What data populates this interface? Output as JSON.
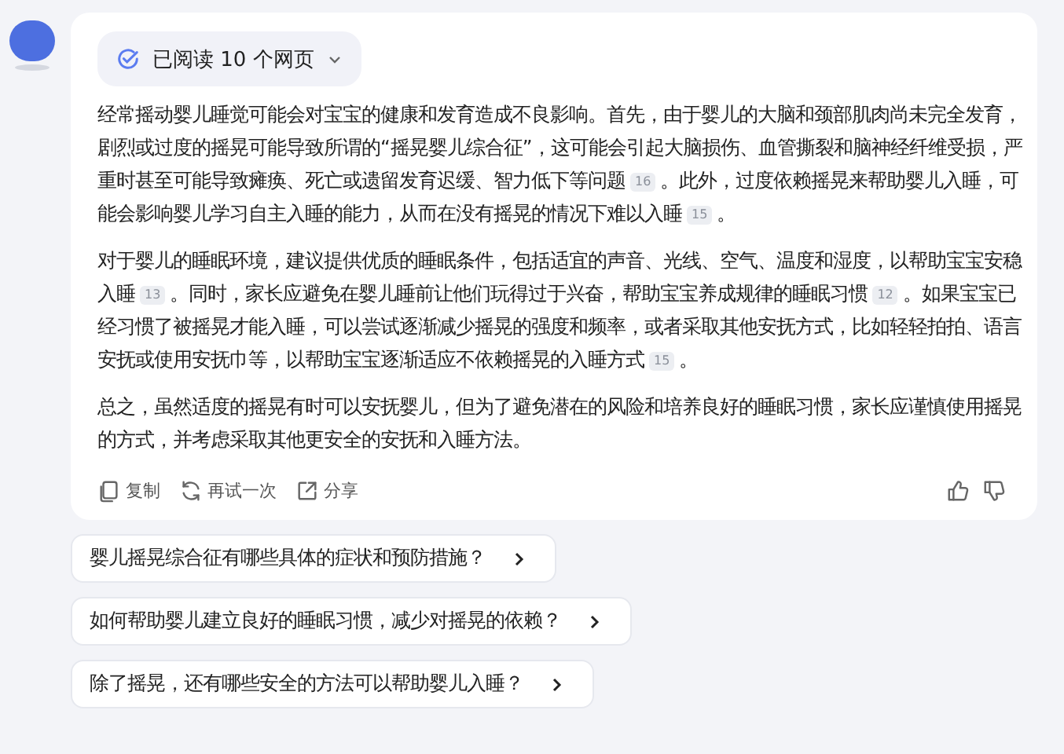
{
  "sources": {
    "label": "已阅读 10 个网页",
    "expanded": false
  },
  "paragraphs": [
    [
      {
        "kind": "text",
        "text": "经常摇动婴儿睡觉可能会对宝宝的健康和发育造成不良影响。首先，由于婴儿的大脑和颈部肌肉尚未完全发育，剧烈或过度的摇晃可能导致所谓的“摇晃婴儿综合征”，这可能会引起大脑损伤、血管撕裂和脑神经纤维受损，严重时甚至可能导致瘫痪、死亡或遗留发育迟缓、智力低下等问题"
      },
      {
        "kind": "cite",
        "text": "16"
      },
      {
        "kind": "text",
        "text": "。此外，过度依赖摇晃来帮助婴儿入睡，可能会影响婴儿学习自主入睡的能力，从而在没有摇晃的情况下难以入睡"
      },
      {
        "kind": "cite",
        "text": "15"
      },
      {
        "kind": "text",
        "text": "。"
      }
    ],
    [
      {
        "kind": "text",
        "text": "对于婴儿的睡眠环境，建议提供优质的睡眠条件，包括适宜的声音、光线、空气、温度和湿度，以帮助宝宝安稳入睡"
      },
      {
        "kind": "cite",
        "text": "13"
      },
      {
        "kind": "text",
        "text": "。同时，家长应避免在婴儿睡前让他们玩得过于兴奋，帮助宝宝养成规律的睡眠习惯"
      },
      {
        "kind": "cite",
        "text": "12"
      },
      {
        "kind": "text",
        "text": "。如果宝宝已经习惯了被摇晃才能入睡，可以尝试逐渐减少摇晃的强度和频率，或者采取其他安抚方式，比如轻轻拍拍、语言安抚或使用安抚巾等，以帮助宝宝逐渐适应不依赖摇晃的入睡方式"
      },
      {
        "kind": "cite",
        "text": "15"
      },
      {
        "kind": "text",
        "text": "。"
      }
    ],
    [
      {
        "kind": "text",
        "text": "总之，虽然适度的摇晃有时可以安抚婴儿，但为了避免潜在的风险和培养良好的睡眠习惯，家长应谨慎使用摇晃的方式，并考虑采取其他更安全的安抚和入睡方法。"
      }
    ]
  ],
  "actions": [
    {
      "kind": "copy",
      "label": "复制"
    },
    {
      "kind": "retry",
      "label": "再试一次"
    },
    {
      "kind": "share",
      "label": "分享"
    }
  ],
  "feedback": [
    {
      "kind": "like"
    },
    {
      "kind": "dislike"
    }
  ],
  "suggestions": [
    "婴儿摇晃综合征有哪些具体的症状和预防措施？",
    "如何帮助婴儿建立良好的睡眠习惯，减少对摇晃的依赖？",
    "除了摇晃，还有哪些安全的方法可以帮助婴儿入睡？"
  ]
}
